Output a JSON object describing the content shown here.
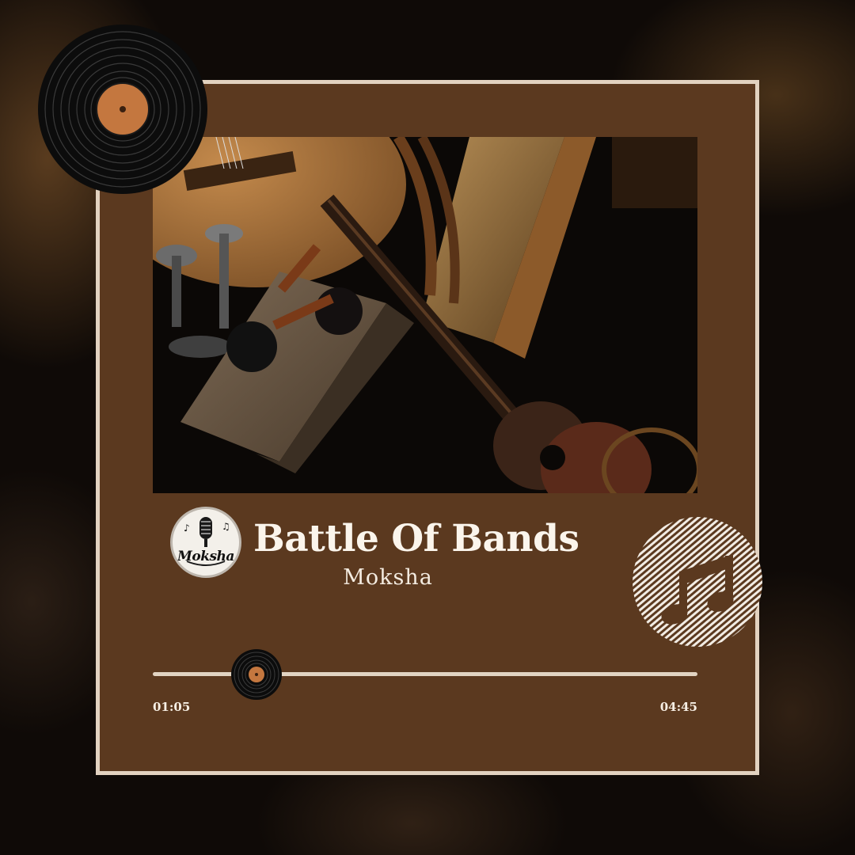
{
  "track": {
    "title": "Battle Of Bands",
    "artist": "Moksha",
    "current_time": "01:05",
    "total_time": "04:45",
    "progress": 0.19
  },
  "logo": {
    "text": "Moksha",
    "icon": "microphone-icon"
  },
  "decor": {
    "vinyl_icon": "vinyl-record-icon",
    "badge_icon": "music-note-icon",
    "photo_subject": "musical-instruments-photo"
  },
  "colors": {
    "card": "#5b391f",
    "frame": "#e2d2c0",
    "text": "#fbf5ec",
    "record_label": "#c4773f"
  }
}
